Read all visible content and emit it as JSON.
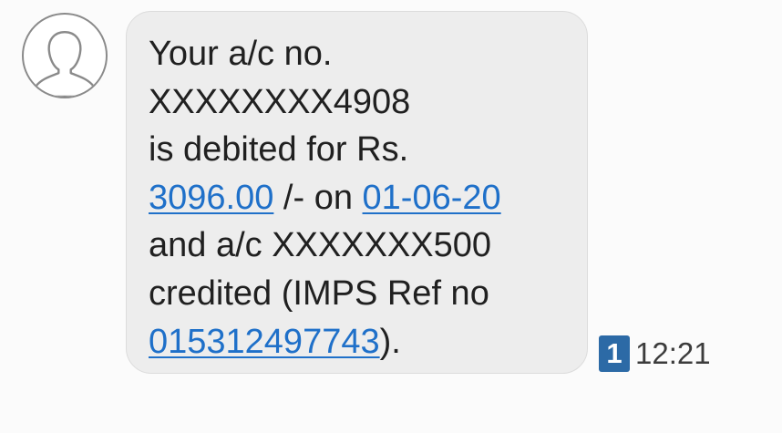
{
  "icons": {
    "avatar": "person-silhouette-icon"
  },
  "colors": {
    "bubble": "#ededed",
    "link": "#1f70c9",
    "sim_badge": "#2c6aa6",
    "text": "#202020"
  },
  "message": {
    "line1": "Your a/c no.",
    "line2": "XXXXXXXX4908",
    "line3": "is debited for Rs.",
    "amount": "3096.00",
    "line4_mid": " /- on ",
    "date": "01-06-20",
    "line5": "and a/c XXXXXXX500",
    "line6": "credited (IMPS Ref no",
    "ref_no": "015312497743",
    "line7_end": ")."
  },
  "meta": {
    "sim_slot": "1",
    "time": "12:21"
  }
}
